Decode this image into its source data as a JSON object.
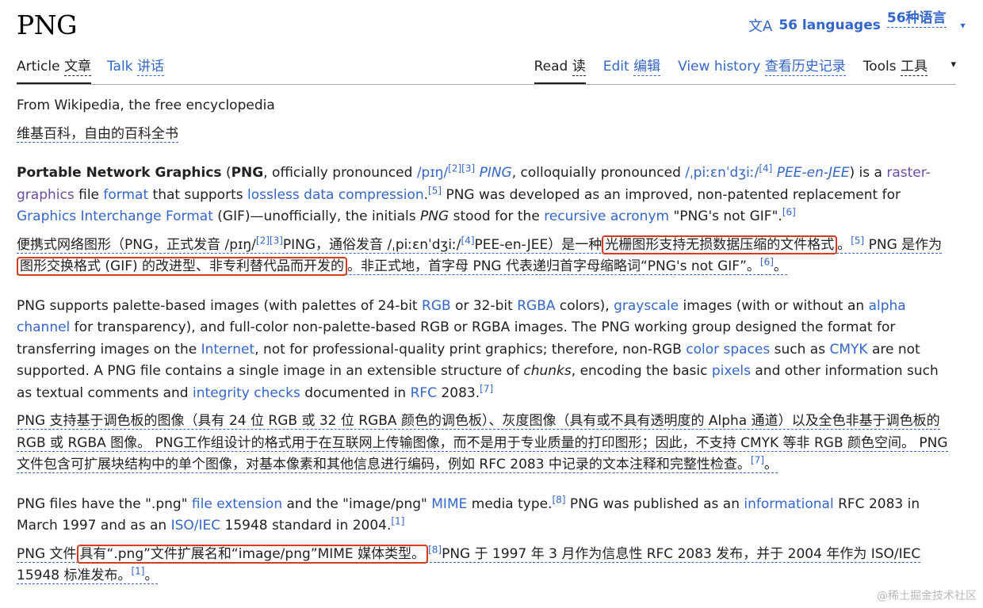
{
  "header": {
    "title": "PNG",
    "lang_icon": "translate-icon",
    "lang_en": "56 languages",
    "lang_zh": "56种语言",
    "chevron": "▾"
  },
  "tabs_left": [
    {
      "en": "Article",
      "zh": "文章"
    },
    {
      "en": "Talk",
      "zh": "讲话"
    }
  ],
  "tabs_right": [
    {
      "en": "Read",
      "zh": "读"
    },
    {
      "en": "Edit",
      "zh": "编辑"
    },
    {
      "en": "View history",
      "zh": "查看历史记录"
    },
    {
      "en": "Tools",
      "zh": "工具"
    }
  ],
  "tagline": "From Wikipedia, the free encyclopedia",
  "tagline_zh": "维基百科，自由的百科全书",
  "p1": {
    "b1": "Portable Network Graphics",
    "t1": " (",
    "b2": "PNG",
    "t2": ", officially pronounced ",
    "ipa1": "/pɪŋ/",
    "s1": "[2]",
    "s2": "[3]",
    "i1": "PING",
    "t3": ", colloquially pronounced ",
    "ipa2": "/ˌpiːɛnˈdʒiː/",
    "s3": "[4]",
    "i2": "PEE-en-JEE",
    "t4": ") is a ",
    "l1": "raster-graphics",
    "t5": " file ",
    "l2": "format",
    "t6": " that supports ",
    "l3": "lossless data compression",
    "s4": "[5]",
    "t7": " PNG was developed as an improved, non-patented replacement for ",
    "l4": "Graphics Interchange Format",
    "t8": " (GIF)—unofficially, the initials ",
    "i3": "PNG",
    "t9": " stood for the ",
    "l5": "recursive acronym",
    "t10": " \"PNG's not GIF\".",
    "s5": "[6]"
  },
  "p1zh": {
    "t1": "便携式网络图形（PNG，正式发音 /pɪŋ/",
    "s1": "[2]",
    "s2": "[3]",
    "t2": "PING，通俗发音 /ˌpiːɛnˈdʒiː/",
    "s3": "[4]",
    "t3": "PEE-en-JEE）是一种",
    "h1": "光栅图形支持无损数据压缩的文件格式",
    "t4": "。",
    "s4": "[5]",
    "t5": " PNG 是作为",
    "h2": "图形交换格式 (GIF) 的改进型、非专利替代品而开发的",
    "t6": "。非正式地，首字母 PNG 代表递归首字母缩略词“PNG's not GIF”。",
    "s5": "[6]",
    "t7": "。"
  },
  "p2": {
    "t1": "PNG supports palette-based images (with palettes of 24-bit ",
    "l1": "RGB",
    "t2": " or 32-bit ",
    "l2": "RGBA",
    "t3": " colors), ",
    "l3": "grayscale",
    "t4": " images (with or without an ",
    "l4": "alpha channel",
    "t5": " for transparency), and full-color non-palette-based RGB or RGBA images. The PNG working group designed the format for transferring images on the ",
    "l5": "Internet",
    "t6": ", not for professional-quality print graphics; therefore, non-RGB ",
    "l6": "color spaces",
    "t7": " such as ",
    "l7": "CMYK",
    "t8": " are not supported. A PNG file contains a single image in an extensible structure of ",
    "i1": "chunks",
    "t9": ", encoding the basic ",
    "l8": "pixels",
    "t10": " and other information such as textual comments and ",
    "l9": "integrity checks",
    "t11": " documented in ",
    "l10": "RFC",
    "t12": " 2083.",
    "s1": "[7]"
  },
  "p2zh": {
    "t1": "PNG 支持基于调色板的图像（具有 24 位 RGB 或 32 位 RGBA 颜色的调色板）、灰度图像（具有或不具有透明度的 Alpha 通道）以及全色非基于调色板的 RGB 或 RGBA 图像。 PNG工作组设计的格式用于在互联网上传输图像，而不是用于专业质量的打印图形；因此，不支持 CMYK 等非 RGB 颜色空间。 PNG 文件包含可扩展块结构中的单个图像，对基本像素和其他信息进行编码，例如 RFC 2083 中记录的文本注释和完整性检查。",
    "s1": "[7]",
    "t2": "。"
  },
  "p3": {
    "t1": "PNG files have the \".png\" ",
    "l1": "file extension",
    "t2": " and the \"image/png\" ",
    "l2": "MIME",
    "t3": " media type.",
    "s1": "[8]",
    "t4": " PNG was published as an ",
    "l3": "informational",
    "t5": " RFC 2083 in March 1997 and as an ",
    "l4": "ISO/IEC",
    "t6": " 15948 standard in 2004.",
    "s2": "[1]"
  },
  "p3zh": {
    "t1": "PNG 文件",
    "h1": "具有“.png”文件扩展名和“image/png”MIME 媒体类型。",
    "s1": "[8]",
    "t2": "PNG 于 1997 年 3 月作为信息性 RFC 2083 发布，并于 2004 年作为 ISO/IEC 15948 标准发布。",
    "s2": "[1]",
    "t3": "。"
  },
  "watermark": "@稀土掘金技术社区"
}
